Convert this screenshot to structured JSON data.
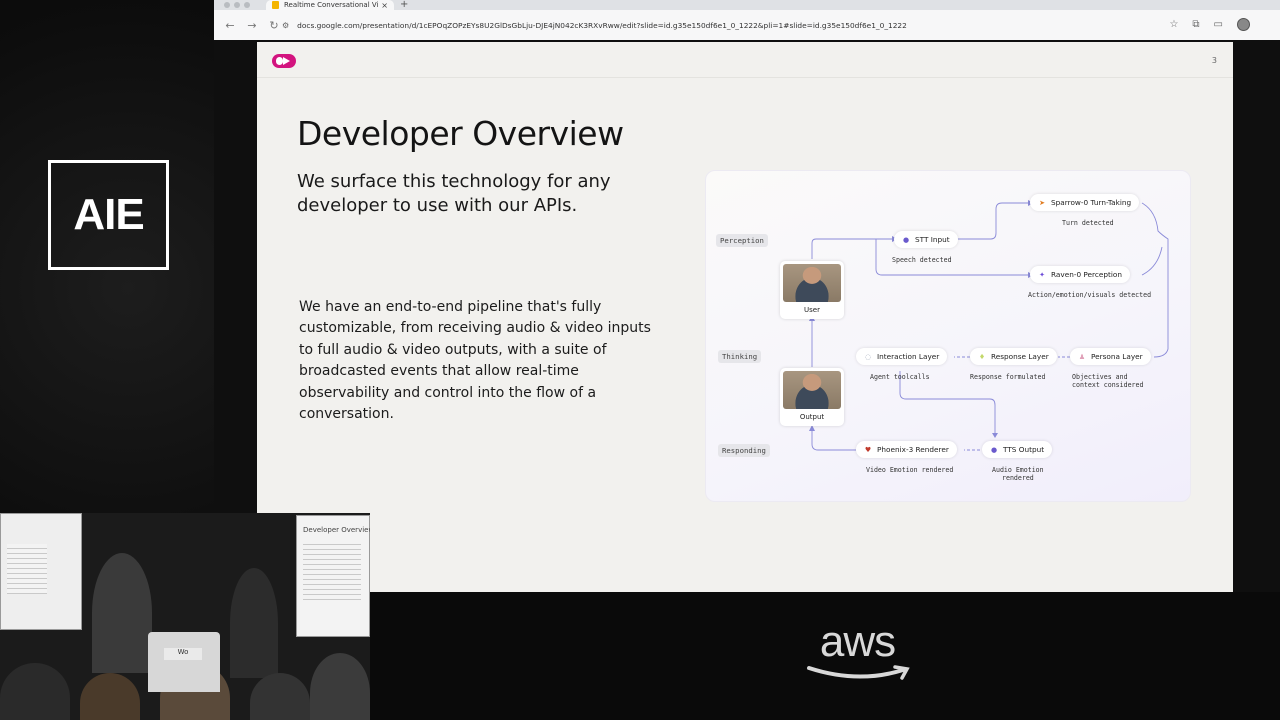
{
  "event_logo": "AIE",
  "sponsor_logo": "aws",
  "browser": {
    "tab_title": "Realtime Conversational Vid",
    "tab_close": "×",
    "new_tab": "+",
    "url": "docs.google.com/presentation/d/1cEPOqZOPzEYs8U2GlDsGbLju-DJE4jN042cK3RXvRww/edit?slide=id.g35e150df6e1_0_1222&pli=1#slide=id.g35e150df6e1_0_1222",
    "icons": [
      "back-icon",
      "forward-icon",
      "reload-icon",
      "site-settings-icon",
      "star-icon",
      "extensions-icon",
      "sidepanel-icon",
      "profile-icon"
    ]
  },
  "slide": {
    "number": "3",
    "title": "Developer Overview",
    "subtitle": "We surface this technology for any developer to use with our APIs.",
    "body": "We have an end-to-end pipeline that's fully customizable, from receiving audio & video inputs to full audio & video outputs, with a suite of broadcasted events that allow real-time observability and control into the flow of a conversation.",
    "brand_color": "#d3147f"
  },
  "diagram": {
    "stages": {
      "perception": "Perception",
      "thinking": "Thinking",
      "responding": "Responding"
    },
    "user_label": "User",
    "output_label": "Output",
    "nodes": {
      "stt_input": "STT Input",
      "sparrow": "Sparrow-0 Turn-Taking",
      "raven": "Raven-0 Perception",
      "interaction": "Interaction Layer",
      "response": "Response Layer",
      "persona": "Persona Layer",
      "phoenix": "Phoenix-3 Renderer",
      "tts": "TTS Output"
    },
    "captions": {
      "speech_detected": "Speech detected",
      "turn_detected": "Turn detected",
      "action_detected": "Action/emotion/visuals detected",
      "agent_toolcalls": "Agent toolcalls",
      "response_formulated": "Response formulated",
      "objectives_1": "Objectives and",
      "objectives_2": "context considered",
      "video_emotion": "Video Emotion rendered",
      "audio_emotion_1": "Audio Emotion",
      "audio_emotion_2": "rendered"
    }
  },
  "inset": {
    "mini_slide_title": "Developer Overview",
    "podium_plate": "Wo"
  }
}
